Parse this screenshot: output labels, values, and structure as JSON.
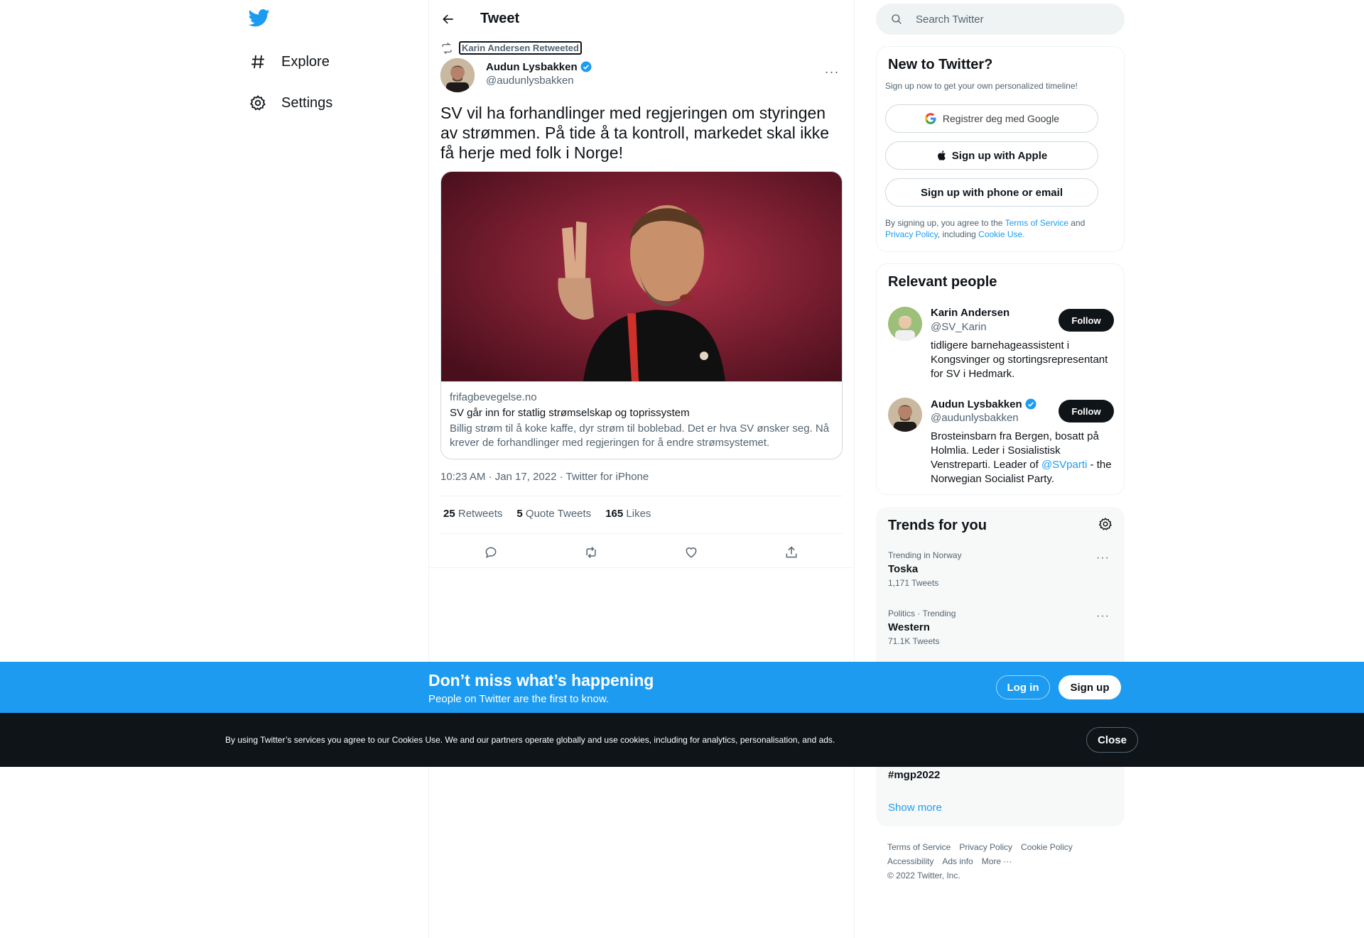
{
  "nav": {
    "explore": "Explore",
    "settings": "Settings"
  },
  "header": {
    "title": "Tweet"
  },
  "tweet": {
    "retweeted_by": "Karin Andersen Retweeted",
    "author_name": "Audun Lysbakken",
    "author_handle": "@audunlysbakken",
    "more": "···",
    "text": "SV vil ha forhandlinger med regjeringen om styringen av strømmen. På tide å ta kontroll, markedet skal ikke få herje med folk i Norge!",
    "card": {
      "domain": "frifagbevegelse.no",
      "title": "SV går inn for statlig strømselskap og toprissystem",
      "description": "Billig strøm til å koke kaffe, dyr strøm til boblebad. Det er hva SV ønsker seg. Nå krever de forhandlinger med regjeringen for å endre strømsystemet."
    },
    "meta": "10:23 AM · Jan 17, 2022 · Twitter for iPhone",
    "stats": {
      "retweets_count": "25",
      "retweets_label": "Retweets",
      "quotes_count": "5",
      "quotes_label": "Quote Tweets",
      "likes_count": "165",
      "likes_label": "Likes"
    }
  },
  "search": {
    "placeholder": "Search Twitter"
  },
  "new_to_twitter": {
    "title": "New to Twitter?",
    "subtitle": "Sign up now to get your own personalized timeline!",
    "google": "Registrer deg med Google",
    "apple": "Sign up with Apple",
    "phone": "Sign up with phone or email",
    "terms_1": "By signing up, you agree to the ",
    "terms_link": "Terms of Service",
    "terms_2": " and",
    "privacy_link": "Privacy Policy",
    "terms_3": ", including ",
    "cookie_link": "Cookie Use."
  },
  "relevant_people": {
    "title": "Relevant people",
    "people": [
      {
        "name": "Karin Andersen",
        "handle": "@SV_Karin",
        "bio": "tidligere barnehageassistent i Kongsvinger og stortingsrepresentant for SV i Hedmark.",
        "follow": "Follow"
      },
      {
        "name": "Audun Lysbakken",
        "handle": "@audunlysbakken",
        "bio_1": "Brosteinsbarn fra Bergen, bosatt på Holmlia. Leder i Sosialistisk Venstreparti. Leader of ",
        "bio_link": "@SVparti",
        "bio_2": " - the Norwegian Socialist Party.",
        "follow": "Follow"
      }
    ]
  },
  "trends": {
    "title": "Trends for you",
    "items": [
      {
        "context": "Trending in Norway",
        "name": "Toska",
        "count": "1,171 Tweets"
      },
      {
        "context": "Politics · Trending",
        "name": "Western",
        "count": "71.1K Tweets"
      },
      {
        "name": "#mgp2022"
      }
    ],
    "show_more": "Show more"
  },
  "footer": {
    "terms": "Terms of Service",
    "privacy": "Privacy Policy",
    "cookie": "Cookie Policy",
    "accessibility": "Accessibility",
    "ads": "Ads info",
    "more": "More ···",
    "copyright": "© 2022 Twitter, Inc."
  },
  "banner": {
    "title": "Don’t miss what’s happening",
    "subtitle": "People on Twitter are the first to know.",
    "login": "Log in",
    "signup": "Sign up"
  },
  "cookies": {
    "text": "By using Twitter’s services you agree to our Cookies Use. We and our partners operate globally and use cookies, including for analytics, personalisation, and ads.",
    "close": "Close"
  },
  "colors": {
    "brand": "#1d9bf0",
    "text": "#0f1419",
    "secondary": "#536471",
    "cookie_bar": "#0f1419"
  }
}
